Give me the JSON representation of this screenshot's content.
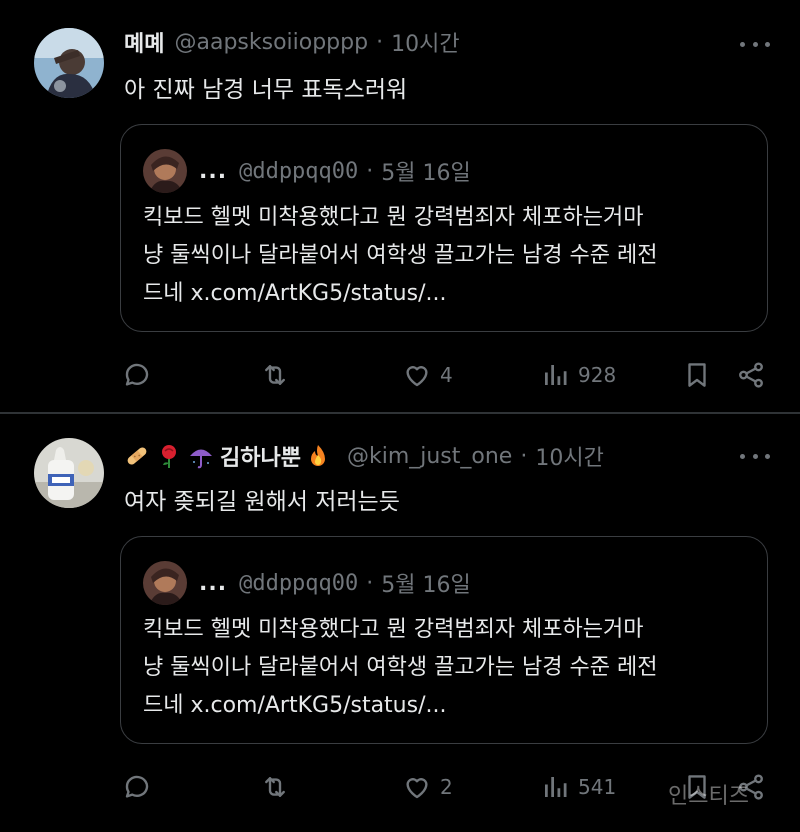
{
  "posts": [
    {
      "display_name": "몌몌",
      "handle": "@aapsksoiiopppp",
      "separator": "·",
      "time": "10시간",
      "text": "아 진짜 남경 너무 표독스러워",
      "quote": {
        "name": "...",
        "handle": "@ddppqq00",
        "separator": "·",
        "date": "5월 16일",
        "lines": [
          "킥보드 헬멧 미착용했다고 뭔 강력범죄자 체포하는거마",
          "냥 둘씩이나 달라붙어서 여학생 끌고가는 남경 수준 레전",
          "드네 x.com/ArtKG5/status/..."
        ]
      },
      "actions": {
        "like_count": "4",
        "view_count": "928"
      }
    },
    {
      "display_name": "김하나뿐",
      "name_emojis_before": [
        "bandage-emoji",
        "rose-emoji",
        "umbrella-emoji"
      ],
      "name_emoji_after": "fire-emoji",
      "handle": "@kim_just_one",
      "separator": "·",
      "time": "10시간",
      "text": "여자 좆되길 원해서 저러는듯",
      "quote": {
        "name": "...",
        "handle": "@ddppqq00",
        "separator": "·",
        "date": "5월 16일",
        "lines": [
          "킥보드 헬멧 미착용했다고 뭔 강력범죄자 체포하는거마",
          "냥 둘씩이나 달라붙어서 여학생 끌고가는 남경 수준 레전",
          "드네 x.com/ArtKG5/status/..."
        ]
      },
      "actions": {
        "like_count": "2",
        "view_count": "541"
      }
    }
  ],
  "icons": {
    "reply": "reply-icon",
    "repost": "repost-icon",
    "like": "heart-icon",
    "views": "views-icon",
    "bookmark": "bookmark-icon",
    "share": "share-icon",
    "more": "more-options-icon"
  },
  "colors": {
    "background": "#000000",
    "text_primary": "#e7e9ea",
    "text_secondary": "#71767b",
    "border": "#2f3336"
  },
  "watermark": "인스티즈"
}
